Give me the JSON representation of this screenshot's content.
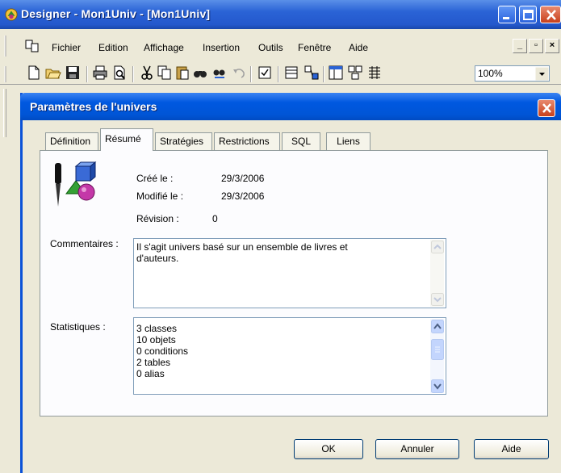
{
  "window": {
    "title": "Designer - Mon1Univ - [Mon1Univ]"
  },
  "menubar": {
    "items": [
      "Fichier",
      "Edition",
      "Affichage",
      "Insertion",
      "Outils",
      "Fenêtre",
      "Aide"
    ]
  },
  "toolbar": {
    "zoom": "100%"
  },
  "dialog": {
    "title": "Paramètres de l'univers",
    "tabs": [
      "Définition",
      "Résumé",
      "Stratégies",
      "Restrictions",
      "SQL",
      "Liens"
    ],
    "active_tab": "Résumé",
    "created_label": "Créé le :",
    "created_value": "29/3/2006",
    "modified_label": "Modifié le :",
    "modified_value": "29/3/2006",
    "revision_label": "Révision :",
    "revision_value": "0",
    "comments_label": "Commentaires :",
    "comments_lines": [
      "Il s'agit univers basé sur un ensemble de livres et",
      "d'auteurs."
    ],
    "stats_label": "Statistiques :",
    "stats_lines": [
      "3 classes",
      "10 objets",
      "0 conditions",
      "2 tables",
      "0 alias"
    ],
    "ok_label": "OK",
    "cancel_label": "Annuler",
    "help_label": "Aide"
  },
  "colors": {
    "titlebar": "#2458cc",
    "dialog_titlebar": "#0055d6",
    "face": "#ece9d8"
  }
}
